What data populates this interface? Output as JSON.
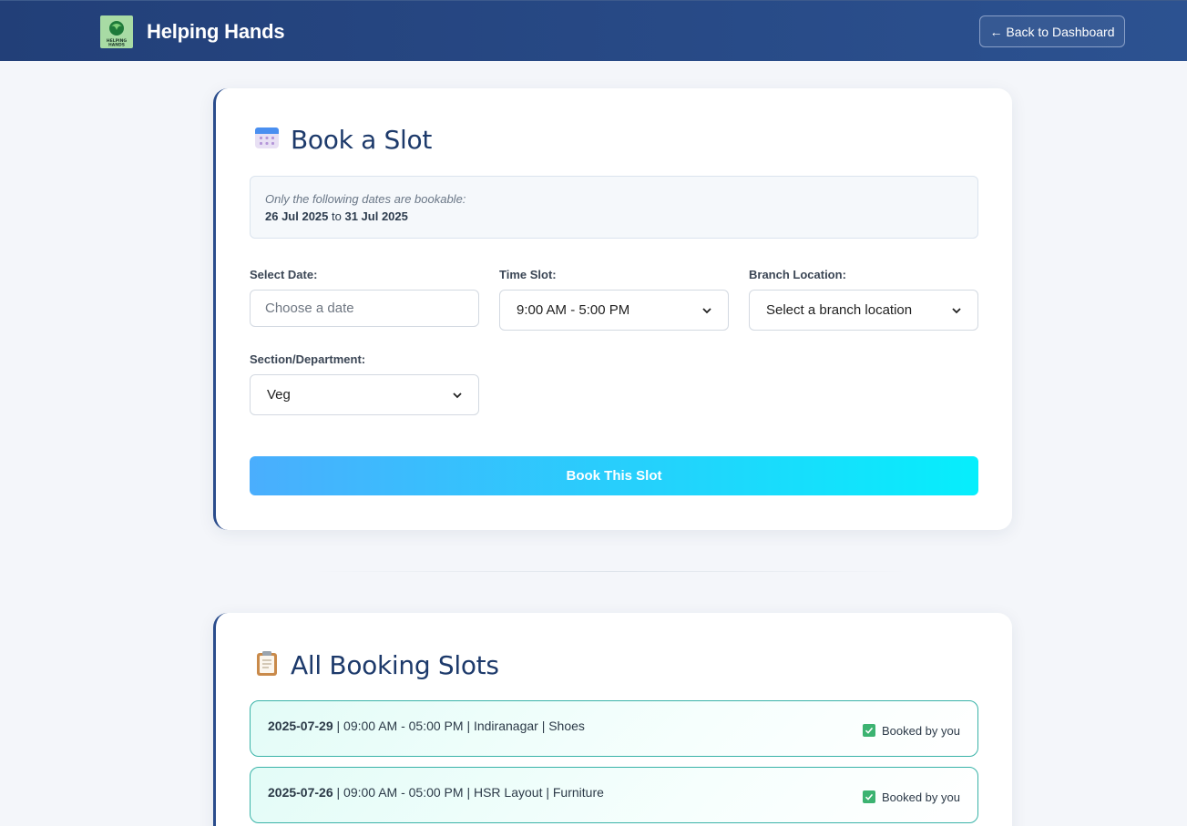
{
  "header": {
    "brand_name": "Helping Hands",
    "logo_text": "HELPING HANDS",
    "back_button_label": "← Back to Dashboard"
  },
  "book_section": {
    "title": "Book a Slot",
    "icon": "calendar-icon",
    "info_note": "Only the following dates are bookable:",
    "date_from": "26 Jul 2025",
    "date_to_word": "to",
    "date_to": "31 Jul 2025",
    "fields": {
      "date_label": "Select Date:",
      "date_placeholder": "Choose a date",
      "time_label": "Time Slot:",
      "time_value": "9:00 AM - 5:00 PM",
      "branch_label": "Branch Location:",
      "branch_value": "Select a branch location",
      "section_label": "Section/Department:",
      "section_value": "Veg"
    },
    "submit_label": "Book This Slot"
  },
  "list_section": {
    "title": "All Booking Slots",
    "icon": "clipboard-icon",
    "slots": [
      {
        "date": "2025-07-29",
        "details": " | 09:00 AM - 05:00 PM | Indiranagar | Shoes",
        "status": "Booked by you"
      },
      {
        "date": "2025-07-26",
        "details": " | 09:00 AM - 05:00 PM | HSR Layout | Furniture",
        "status": "Booked by you"
      }
    ]
  },
  "colors": {
    "header_bg": "#223f78",
    "accent": "#2a4c8c",
    "button_gradient_start": "#4aaefd",
    "button_gradient_end": "#06eefc",
    "slot_border": "#3ab3a8",
    "check_green": "#3cb371"
  }
}
